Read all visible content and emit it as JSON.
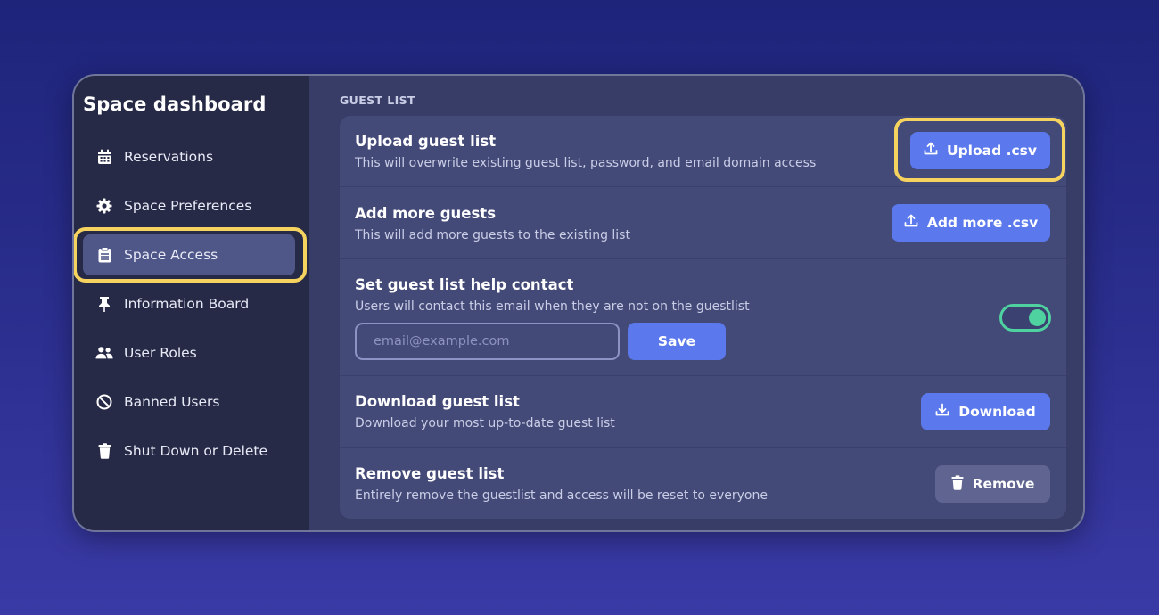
{
  "sidebar": {
    "title": "Space dashboard",
    "items": [
      {
        "label": "Reservations",
        "icon": "calendar-icon",
        "active": false
      },
      {
        "label": "Space Preferences",
        "icon": "gear-icon",
        "active": false
      },
      {
        "label": "Space Access",
        "icon": "clipboard-list-icon",
        "active": true
      },
      {
        "label": "Information Board",
        "icon": "pin-icon",
        "active": false
      },
      {
        "label": "User Roles",
        "icon": "users-icon",
        "active": false
      },
      {
        "label": "Banned Users",
        "icon": "ban-icon",
        "active": false
      },
      {
        "label": "Shut Down or Delete",
        "icon": "trash-icon",
        "active": false
      }
    ]
  },
  "main": {
    "section_label": "GUEST LIST",
    "upload": {
      "title": "Upload guest list",
      "desc": "This will overwrite existing guest list, password, and email domain access",
      "button": "Upload .csv"
    },
    "add_more": {
      "title": "Add more guests",
      "desc": "This will add more guests to the existing list",
      "button": "Add more .csv"
    },
    "help_contact": {
      "title": "Set guest list help contact",
      "desc": "Users will contact this email when they are not on the guestlist",
      "email_placeholder": "email@example.com",
      "save_button": "Save",
      "toggle_on": true
    },
    "download": {
      "title": "Download guest list",
      "desc": "Download your most up-to-date guest list",
      "button": "Download"
    },
    "remove": {
      "title": "Remove guest list",
      "desc": "Entirely remove the guestlist and access will be reset to everyone",
      "button": "Remove"
    }
  },
  "colors": {
    "accent": "#5b79ec",
    "highlight": "#f6d35f",
    "toggle": "#4fd1a0"
  }
}
